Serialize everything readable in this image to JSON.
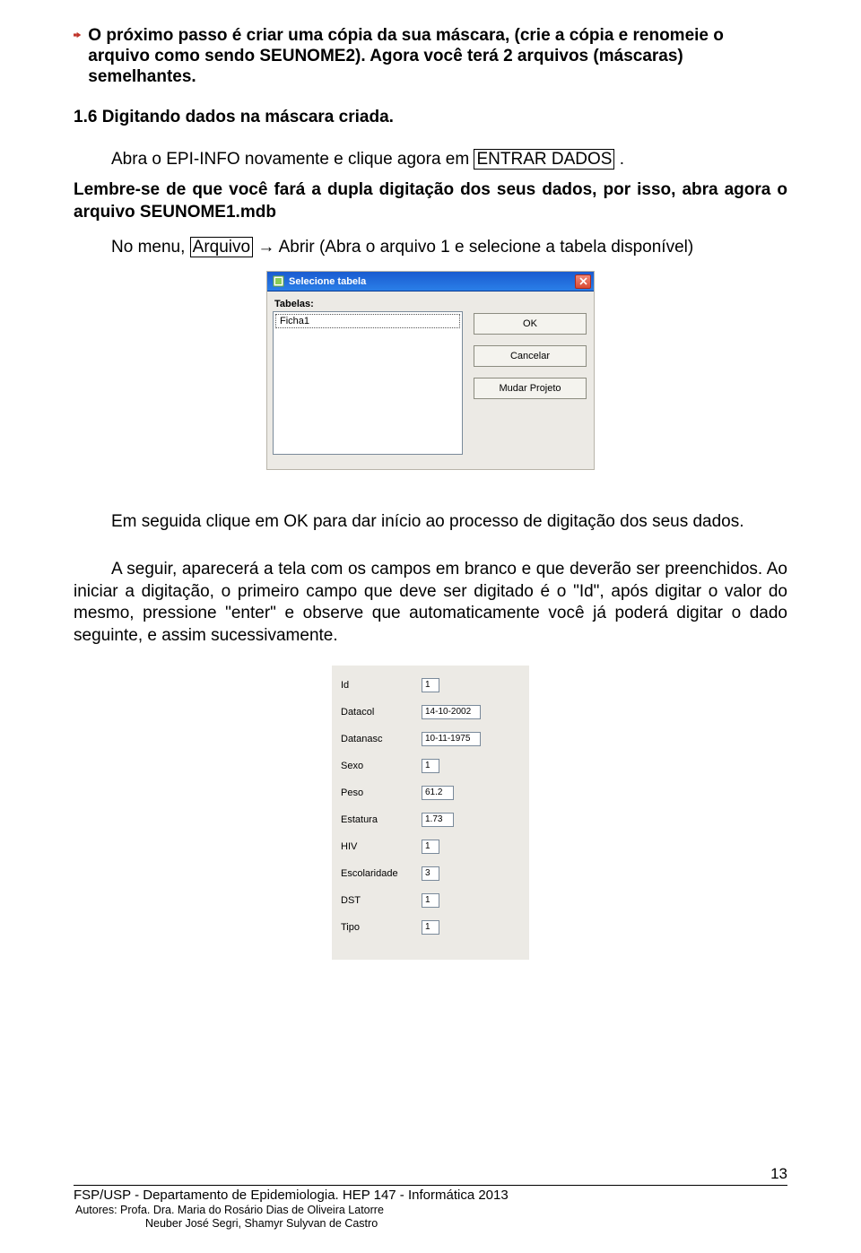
{
  "body": {
    "para1_a": "O próximo passo é criar uma cópia da sua máscara, (crie a cópia e renomeie o arquivo como sendo SEUNOME2). Agora você terá 2 arquivos (máscaras) semelhantes.",
    "heading_1_6": "1.6 Digitando dados na máscara criada.",
    "para_abra_prefix": "Abra o EPI-INFO novamente e clique agora em ",
    "entrar_dados": "ENTRAR DADOS",
    "para_abra_suffix": " .",
    "para_lembre": "Lembre-se de que você fará a dupla digitação dos seus dados, por isso, abra agora o arquivo SEUNOME1.mdb",
    "para_nomenu_a": "No menu, ",
    "arquivo_label": "Arquivo",
    "para_nomenu_b": " → Abrir (Abra o arquivo 1 e selecione a tabela disponível)",
    "para_emseguida": "Em seguida clique em OK para dar início ao processo de digitação dos seus dados.",
    "para_aseguir": "A seguir, aparecerá a tela com os campos em branco e que deverão ser preenchidos. Ao iniciar a digitação, o primeiro campo que deve ser digitado é o \"Id\", após digitar o valor do mesmo, pressione \"enter\" e observe que automaticamente você já poderá digitar o dado seguinte, e assim sucessivamente."
  },
  "dialog1": {
    "title": "Selecione tabela",
    "label": "Tabelas:",
    "item": "Ficha1",
    "btn_ok": "OK",
    "btn_cancel": "Cancelar",
    "btn_change": "Mudar Projeto"
  },
  "form2": {
    "fields": [
      {
        "label": "Id",
        "value": "1",
        "w": "w-xxs"
      },
      {
        "label": "Datacol",
        "value": "14-10-2002",
        "w": "w-sm"
      },
      {
        "label": "Datanasc",
        "value": "10-11-1975",
        "w": "w-sm"
      },
      {
        "label": "Sexo",
        "value": "1",
        "w": "w-xxs"
      },
      {
        "label": "Peso",
        "value": "61.2",
        "w": "w-xs"
      },
      {
        "label": "Estatura",
        "value": "1.73",
        "w": "w-xs"
      },
      {
        "label": "HIV",
        "value": "1",
        "w": "w-xxs"
      },
      {
        "label": "Escolaridade",
        "value": "3",
        "w": "w-xxs"
      },
      {
        "label": "DST",
        "value": "1",
        "w": "w-xxs"
      },
      {
        "label": "Tipo",
        "value": "1",
        "w": "w-xxs"
      }
    ]
  },
  "footer": {
    "line1": "FSP/USP - Departamento de Epidemiologia. HEP 147 - Informática  2013",
    "line2": "Autores: Profa. Dra. Maria do Rosário Dias de Oliveira Latorre",
    "line3": "Neuber José Segri, Shamyr Sulyvan de Castro",
    "pagenum": "13"
  }
}
